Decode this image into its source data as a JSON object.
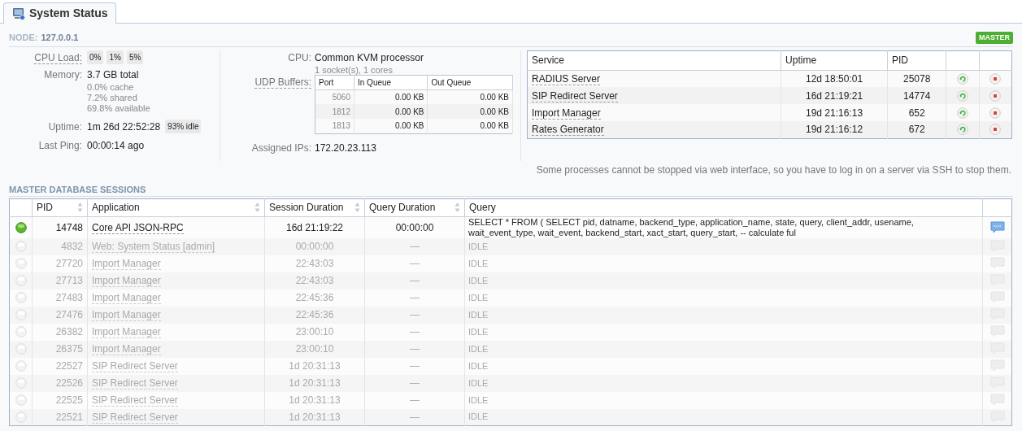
{
  "tab": {
    "label": "System Status",
    "selected": true
  },
  "node": {
    "label": "NODE:",
    "value": "127.0.0.1",
    "badge": "MASTER"
  },
  "stats": {
    "cpu_load": {
      "label": "CPU Load:",
      "values": [
        "0%",
        "1%",
        "5%"
      ]
    },
    "memory": {
      "label": "Memory:",
      "value": "3.7 GB total",
      "details": [
        "0.0% cache",
        "7.2% shared",
        "69.8% available"
      ]
    },
    "uptime": {
      "label": "Uptime:",
      "value": "1m 26d 22:52:28",
      "badge": "93% idle"
    },
    "last_ping": {
      "label": "Last Ping:",
      "value": "00:00:14 ago"
    }
  },
  "cpu": {
    "label": "CPU:",
    "value": "Common KVM processor",
    "detail": "1 socket(s), 1 cores"
  },
  "udp_buffers": {
    "label": "UDP Buffers:",
    "columns": [
      "Port",
      "In Queue",
      "Out Queue"
    ],
    "rows": [
      [
        "5060",
        "0.00 KB",
        "0.00 KB"
      ],
      [
        "1812",
        "0.00 KB",
        "0.00 KB"
      ],
      [
        "1813",
        "0.00 KB",
        "0.00 KB"
      ]
    ]
  },
  "assigned_ips": {
    "label": "Assigned IPs:",
    "value": "172.20.23.113"
  },
  "services": {
    "columns": [
      "Service",
      "Uptime",
      "PID"
    ],
    "rows": [
      {
        "service": "RADIUS Server",
        "uptime": "12d 18:50:01",
        "pid": "25078"
      },
      {
        "service": "SIP Redirect Server",
        "uptime": "16d 21:19:21",
        "pid": "14774"
      },
      {
        "service": "Import Manager",
        "uptime": "19d 21:16:13",
        "pid": "652"
      },
      {
        "service": "Rates Generator",
        "uptime": "19d 21:16:12",
        "pid": "672"
      }
    ],
    "note": "Some processes cannot be stopped via web interface, so you have to log in on a server via SSH to stop them."
  },
  "sessions": {
    "title": "MASTER DATABASE SESSIONS",
    "columns": [
      "PID",
      "Application",
      "Session Duration",
      "Query Duration",
      "Query"
    ],
    "rows": [
      {
        "active": true,
        "pid": "14748",
        "application": "Core API JSON-RPC",
        "session_duration": "16d 21:19:22",
        "query_duration": "00:00:00",
        "query": "SELECT * FROM ( SELECT pid, datname, backend_type, application_name, state, query, client_addr, usename, wait_event_type, wait_event, backend_start, xact_start, query_start, -- calculate ful"
      },
      {
        "active": false,
        "pid": "4832",
        "application": "Web: System Status [admin]",
        "session_duration": "00:00:00",
        "query_duration": "—",
        "query": "IDLE"
      },
      {
        "active": false,
        "pid": "27720",
        "application": "Import Manager",
        "session_duration": "22:43:03",
        "query_duration": "—",
        "query": "IDLE"
      },
      {
        "active": false,
        "pid": "27713",
        "application": "Import Manager",
        "session_duration": "22:43:03",
        "query_duration": "—",
        "query": "IDLE"
      },
      {
        "active": false,
        "pid": "27483",
        "application": "Import Manager",
        "session_duration": "22:45:36",
        "query_duration": "—",
        "query": "IDLE"
      },
      {
        "active": false,
        "pid": "27476",
        "application": "Import Manager",
        "session_duration": "22:45:36",
        "query_duration": "—",
        "query": "IDLE"
      },
      {
        "active": false,
        "pid": "26382",
        "application": "Import Manager",
        "session_duration": "23:00:10",
        "query_duration": "—",
        "query": "IDLE"
      },
      {
        "active": false,
        "pid": "26375",
        "application": "Import Manager",
        "session_duration": "23:00:10",
        "query_duration": "—",
        "query": "IDLE"
      },
      {
        "active": false,
        "pid": "22527",
        "application": "SIP Redirect Server",
        "session_duration": "1d 20:31:13",
        "query_duration": "—",
        "query": "IDLE"
      },
      {
        "active": false,
        "pid": "22526",
        "application": "SIP Redirect Server",
        "session_duration": "1d 20:31:13",
        "query_duration": "—",
        "query": "IDLE"
      },
      {
        "active": false,
        "pid": "22525",
        "application": "SIP Redirect Server",
        "session_duration": "1d 20:31:13",
        "query_duration": "—",
        "query": "IDLE"
      },
      {
        "active": false,
        "pid": "22521",
        "application": "SIP Redirect Server",
        "session_duration": "1d 20:31:13",
        "query_duration": "—",
        "query": "IDLE"
      }
    ]
  }
}
